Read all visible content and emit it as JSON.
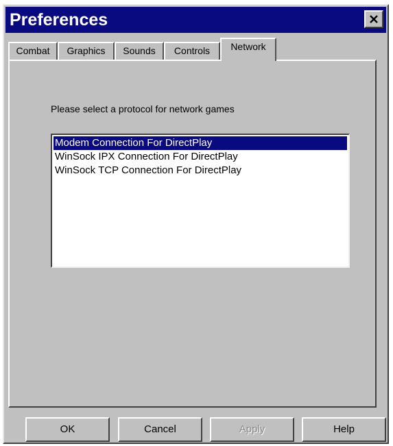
{
  "window": {
    "title": "Preferences"
  },
  "tabs": [
    {
      "label": "Combat"
    },
    {
      "label": "Graphics"
    },
    {
      "label": "Sounds"
    },
    {
      "label": "Controls"
    },
    {
      "label": "Network"
    }
  ],
  "active_tab": "Network",
  "network": {
    "prompt": "Please select a protocol for network games",
    "protocols": [
      {
        "label": "Modem Connection For DirectPlay",
        "selected": true
      },
      {
        "label": "WinSock IPX Connection For DirectPlay",
        "selected": false
      },
      {
        "label": "WinSock TCP Connection For DirectPlay",
        "selected": false
      }
    ]
  },
  "buttons": {
    "ok": "OK",
    "cancel": "Cancel",
    "apply": "Apply",
    "help": "Help"
  },
  "colors": {
    "title_bar": "#0a0a80",
    "selection": "#0a0a80",
    "face": "#c0c0c0"
  },
  "icons": {
    "close": "close-icon"
  }
}
